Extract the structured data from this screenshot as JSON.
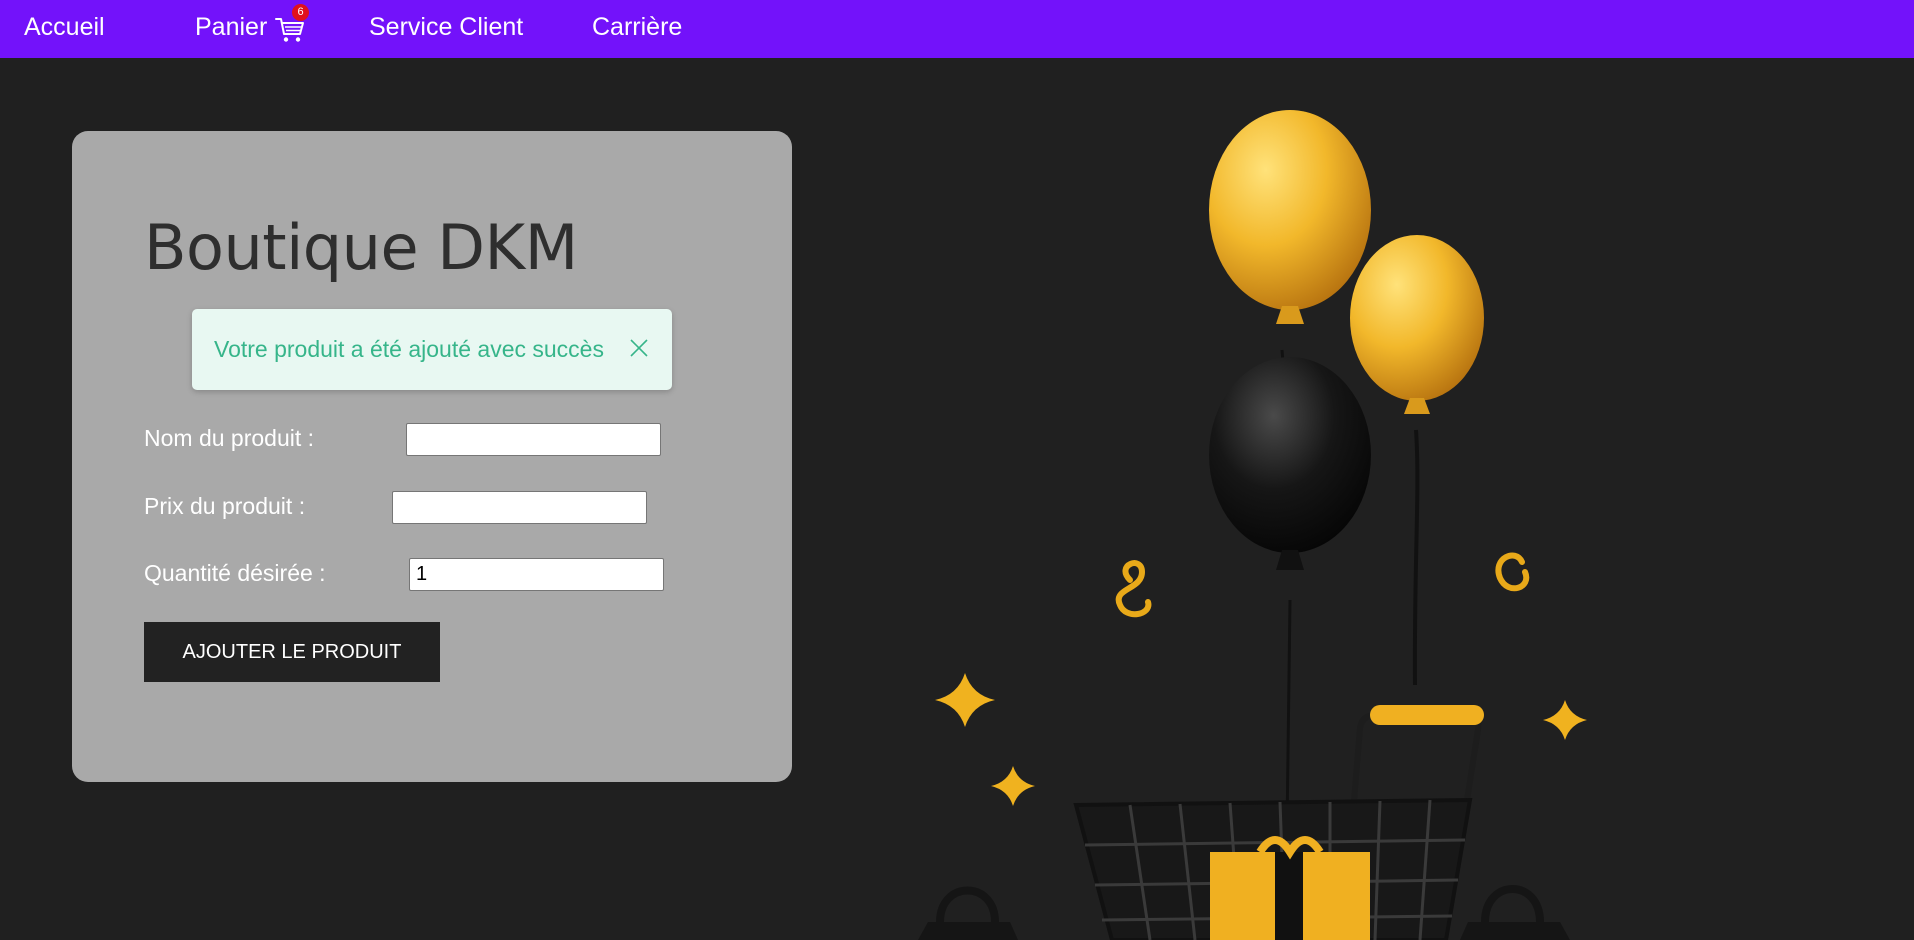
{
  "nav": {
    "home_label": "Accueil",
    "cart_label": "Panier",
    "cart_count": "6",
    "service_label": "Service Client",
    "career_label": "Carrière"
  },
  "main": {
    "title": "Boutique DKM",
    "alert": {
      "message": "Votre produit a été ajouté avec succès"
    },
    "form": {
      "name_label": "Nom du produit :",
      "name_value": "",
      "price_label": "Prix du produit :",
      "price_value": "",
      "quantity_label": "Quantité désirée :",
      "quantity_value": "1",
      "submit_label": "AJOUTER LE PRODUIT"
    }
  },
  "colors": {
    "navbar": "#7312fa",
    "background": "#202020",
    "card": "#a9a9a9",
    "alert_bg": "#e8f8f2",
    "alert_text": "#36b58a",
    "badge": "#e0101d",
    "button": "#222222"
  },
  "icons": {
    "cart": "shopping-cart-icon",
    "close": "close-icon"
  },
  "illustration": "balloons-and-shopping-cart-illustration"
}
